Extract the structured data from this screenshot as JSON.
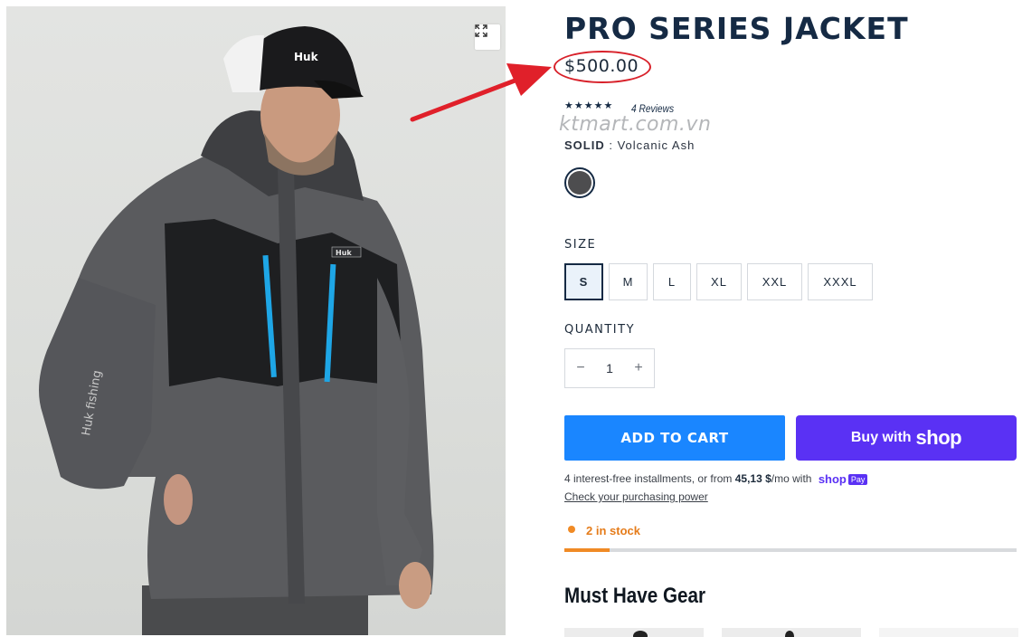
{
  "product": {
    "title": "PRO SERIES JACKET",
    "price": "$500.00",
    "rating": 5,
    "reviews_label": "4 Reviews",
    "variant_label": "SOLID",
    "variant_value": "Volcanic Ash",
    "swatch_color": "#4d4d4f"
  },
  "watermark": "ktmart.com.vn",
  "size": {
    "label": "SIZE",
    "options": [
      "S",
      "M",
      "L",
      "XL",
      "XXL",
      "XXXL"
    ],
    "selected": "S"
  },
  "quantity": {
    "label": "QUANTITY",
    "value": "1",
    "minus": "−",
    "plus": "+"
  },
  "buttons": {
    "add_to_cart": "ADD TO CART",
    "buy_with": "Buy with",
    "shop": "shop"
  },
  "installments": {
    "text_before": "4 interest-free installments, or from ",
    "amount": "45,13 $",
    "text_after": "/mo with",
    "shop_pay_brand": "shop",
    "shop_pay_badge": "Pay",
    "check_link": "Check your purchasing power"
  },
  "stock": {
    "text": "2 in stock",
    "level": 0.1
  },
  "gear": {
    "heading": "Must Have Gear"
  },
  "colors": {
    "navy": "#152a44",
    "cart_blue": "#1a86ff",
    "shop_purple": "#5a31f4",
    "stock_orange": "#f08a25",
    "highlight_red": "#d8212a"
  },
  "icons": {
    "zoom": "expand-icon",
    "arrow": "red-arrow-annotation",
    "star": "star-icon"
  }
}
